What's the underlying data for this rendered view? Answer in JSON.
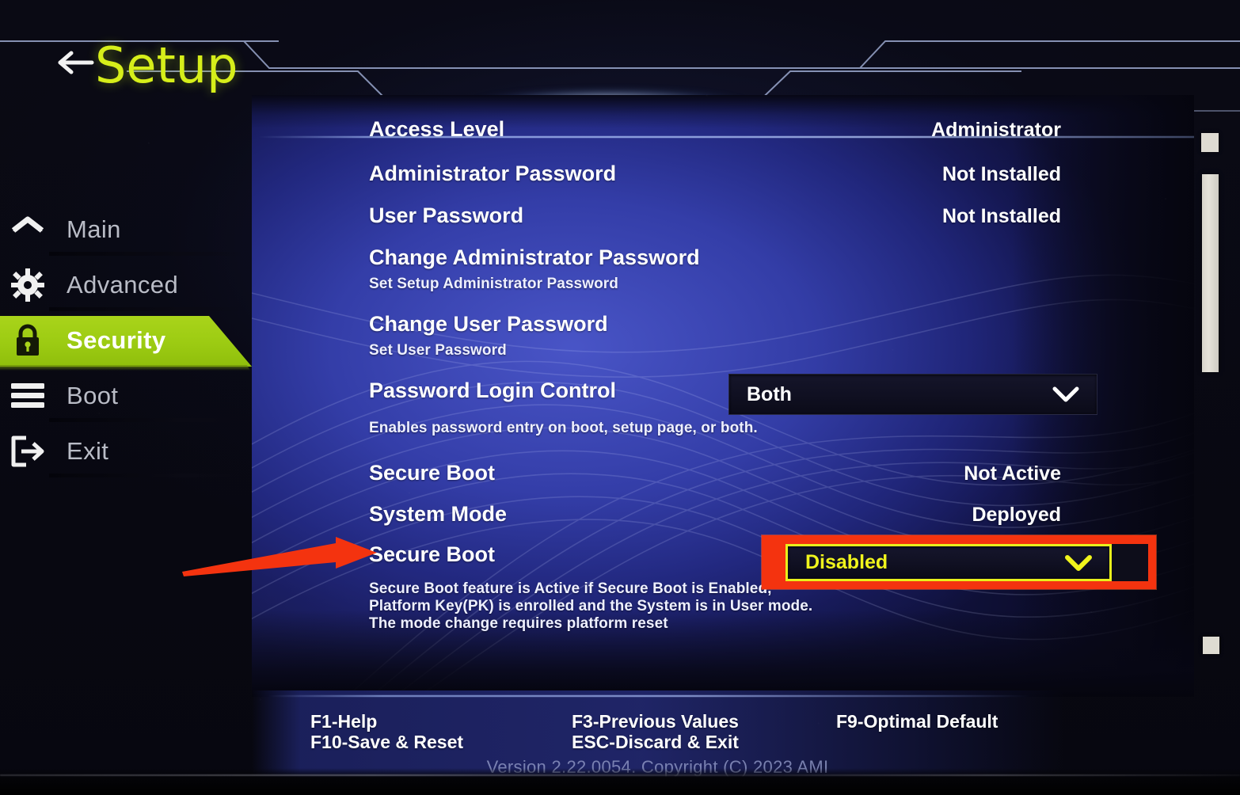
{
  "header": {
    "back_icon": "left-arrow-icon",
    "title": "Setup"
  },
  "sidebar": {
    "items": [
      {
        "label": "Main",
        "icon": "home-icon",
        "active": false
      },
      {
        "label": "Advanced",
        "icon": "gear-icon",
        "active": false
      },
      {
        "label": "Security",
        "icon": "lock-icon",
        "active": true
      },
      {
        "label": "Boot",
        "icon": "layers-icon",
        "active": false
      },
      {
        "label": "Exit",
        "icon": "exit-icon",
        "active": false
      }
    ]
  },
  "main": {
    "rows": [
      {
        "label": "Access Level",
        "value": "Administrator",
        "type": "text"
      },
      {
        "label": "Administrator Password",
        "value": "Not Installed",
        "type": "text"
      },
      {
        "label": "User Password",
        "value": "Not Installed",
        "type": "text"
      },
      {
        "label": "Change Administrator Password",
        "help": "Set Setup Administrator Password",
        "type": "action"
      },
      {
        "label": "Change User Password",
        "help": "Set User Password",
        "type": "action"
      },
      {
        "label": "Password Login Control",
        "value": "Both",
        "help": "Enables password entry on boot, setup page, or both.",
        "type": "dropdown"
      },
      {
        "label": "Secure Boot",
        "value": "Not Active",
        "type": "text"
      },
      {
        "label": "System Mode",
        "value": "Deployed",
        "type": "text"
      },
      {
        "label": "Secure Boot",
        "value": "Disabled",
        "type": "dropdown-focused"
      }
    ],
    "access_level": {
      "label": "Access Level",
      "value": "Administrator"
    },
    "admin_password": {
      "label": "Administrator Password",
      "value": "Not Installed"
    },
    "user_password": {
      "label": "User Password",
      "value": "Not Installed"
    },
    "change_admin_password": {
      "label": "Change Administrator Password",
      "help": "Set Setup Administrator Password"
    },
    "change_user_password": {
      "label": "Change User Password",
      "help": "Set User Password"
    },
    "password_login_control": {
      "label": "Password Login Control",
      "value": "Both",
      "help": "Enables password entry on boot, setup page, or both."
    },
    "secure_boot_status": {
      "label": "Secure Boot",
      "value": "Not Active"
    },
    "system_mode": {
      "label": "System Mode",
      "value": "Deployed"
    },
    "secure_boot_control": {
      "label": "Secure Boot",
      "value": "Disabled",
      "help_line1": "Secure Boot feature is Active if Secure Boot is Enabled,",
      "help_line2": "Platform Key(PK) is enrolled and the System is in User mode.",
      "help_line3": "The mode change requires platform reset"
    }
  },
  "footer": {
    "keys": [
      "F1-Help",
      "F10-Save & Reset",
      "F3-Previous Values",
      "ESC-Discard & Exit",
      "F9-Optimal Default"
    ],
    "f1": "F1-Help",
    "f10": "F10-Save & Reset",
    "f3": "F3-Previous Values",
    "esc": "ESC-Discard & Exit",
    "f9": "F9-Optimal Default",
    "version": "Version 2.22.0054. Copyright (C) 2023 AMI"
  },
  "scrollbar": {
    "up_icon": "scroll-up-button",
    "down_icon": "scroll-down-button"
  },
  "annotations": {
    "arrow_icon": "red-pointer-arrow",
    "highlight_icon": "red-highlight-box",
    "color": "#f4330f"
  },
  "colors": {
    "accent_green": "#9ccb12",
    "title_yellow": "#d6ee1a",
    "focus_yellow": "#f0f41c",
    "panel_blue": "#343ca8",
    "annotation_red": "#f4330f"
  }
}
